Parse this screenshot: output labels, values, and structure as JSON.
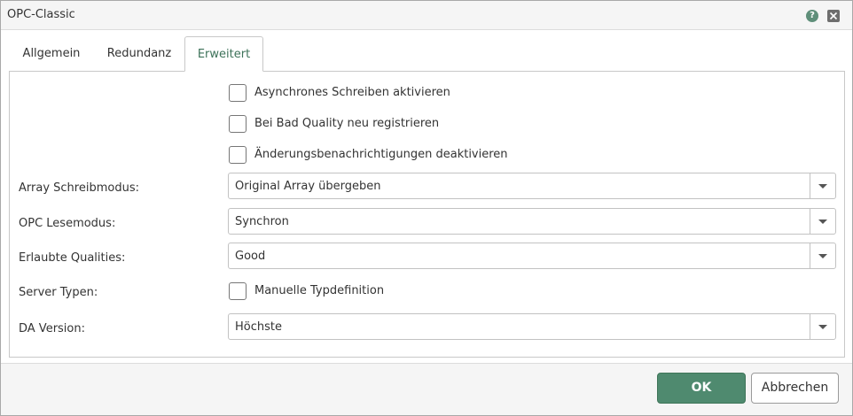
{
  "window": {
    "title": "OPC-Classic",
    "help_glyph": "?"
  },
  "tabs": [
    {
      "label": "Allgemein",
      "active": false
    },
    {
      "label": "Redundanz",
      "active": false
    },
    {
      "label": "Erweitert",
      "active": true
    }
  ],
  "options": {
    "async_write": {
      "label": "Asynchrones Schreiben aktivieren",
      "checked": false
    },
    "bad_quality_reregister": {
      "label": "Bei Bad Quality neu registrieren",
      "checked": false
    },
    "disable_change_notifications": {
      "label": "Änderungsbenachrichtigungen deaktivieren",
      "checked": false
    }
  },
  "fields": {
    "array_write_mode": {
      "label": "Array Schreibmodus:",
      "value": "Original Array übergeben"
    },
    "opc_read_mode": {
      "label": "OPC Lesemodus:",
      "value": "Synchron"
    },
    "allowed_qualities": {
      "label": "Erlaubte Qualities:",
      "value": "Good"
    },
    "server_types": {
      "label": "Server Typen:",
      "checkbox_label": "Manuelle Typdefinition",
      "checked": false
    },
    "da_version": {
      "label": "DA Version:",
      "value": "Höchste"
    }
  },
  "footer": {
    "ok_label": "OK",
    "cancel_label": "Abbrechen"
  },
  "colors": {
    "accent": "#4f8a6f",
    "active_tab_text": "#3d7259"
  }
}
